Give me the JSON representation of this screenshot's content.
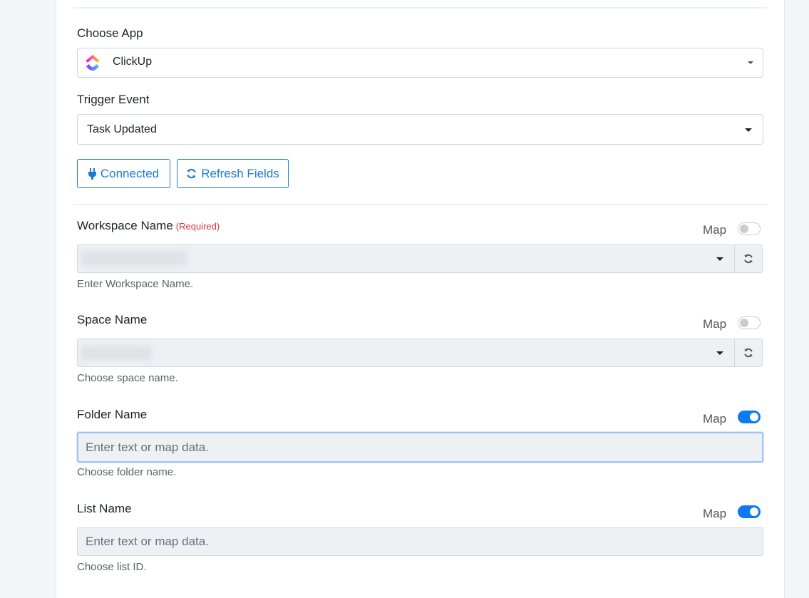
{
  "choose_app": {
    "label": "Choose App",
    "value": "ClickUp"
  },
  "trigger_event": {
    "label": "Trigger Event",
    "value": "Task Updated"
  },
  "buttons": {
    "connected": "Connected",
    "refresh_fields": "Refresh Fields"
  },
  "fields": [
    {
      "label": "Workspace Name",
      "required": "(Required)",
      "map_label": "Map",
      "map_on": false,
      "value": "",
      "help": "Enter Workspace Name."
    },
    {
      "label": "Space Name",
      "map_label": "Map",
      "map_on": false,
      "value": "",
      "help": "Choose space name."
    },
    {
      "label": "Folder Name",
      "map_label": "Map",
      "map_on": true,
      "placeholder": "Enter text or map data.",
      "help": "Choose folder name."
    },
    {
      "label": "List Name",
      "map_label": "Map",
      "map_on": true,
      "placeholder": "Enter text or map data.",
      "help": "Choose list ID."
    }
  ],
  "colors": {
    "accent": "#1a7bd0",
    "toggle_on": "#0d7af0",
    "required": "#d63340"
  }
}
